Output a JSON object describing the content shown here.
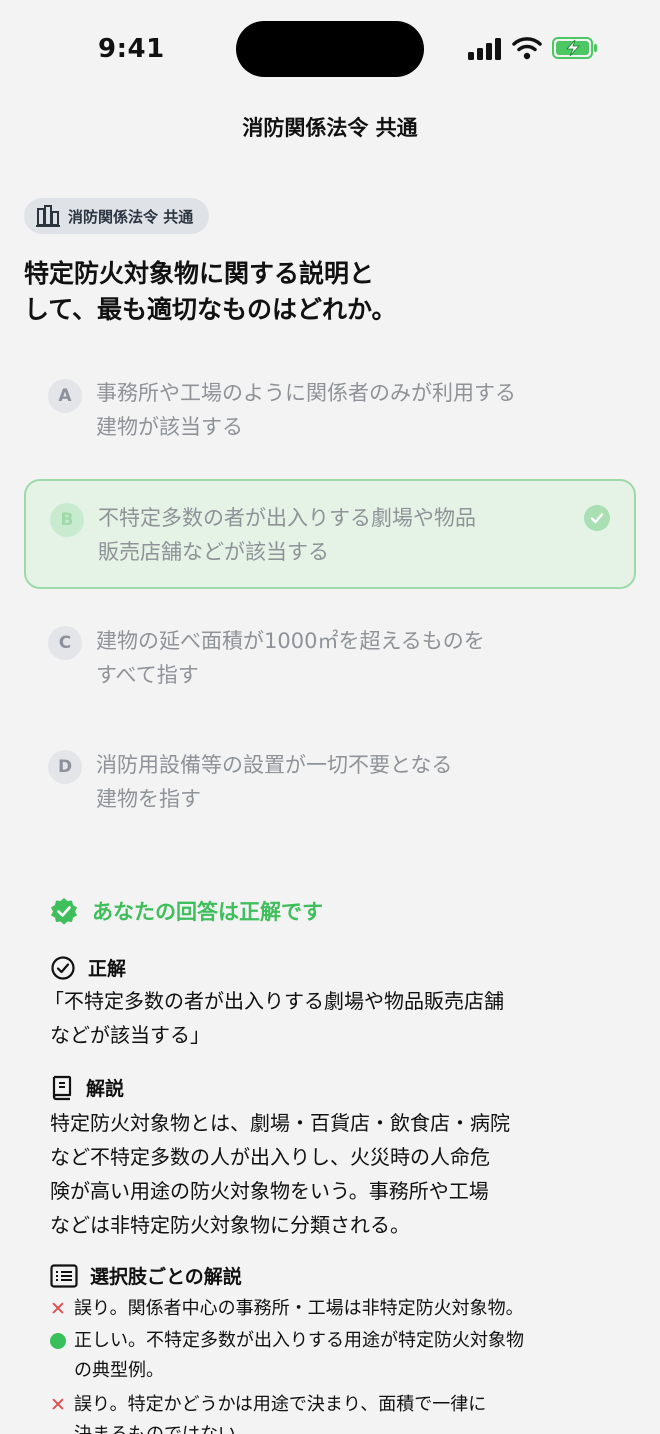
{
  "status_bar": {
    "time": "9:41"
  },
  "nav": {
    "title": "消防関係法令 共通"
  },
  "tag": {
    "label": "消防関係法令 共通"
  },
  "question": {
    "line1": "特定防火対象物に関する説明と",
    "line2": "して、最も適切なものはどれか。"
  },
  "options": [
    {
      "letter": "A",
      "line1": "事務所や工場のように関係者のみが利用する",
      "line2": "建物が該当する"
    },
    {
      "letter": "B",
      "line1": "不特定多数の者が出入りする劇場や物品",
      "line2": "販売店舗などが該当する"
    },
    {
      "letter": "C",
      "line1": "建物の延べ面積が1000㎡を超えるものを",
      "line2": "すべて指す"
    },
    {
      "letter": "D",
      "line1": "消防用設備等の設置が一切不要となる",
      "line2": "建物を指す"
    }
  ],
  "result": {
    "label": "あなたの回答は正解です"
  },
  "correct": {
    "heading": "正解",
    "line1": "「不特定多数の者が出入りする劇場や物品販売店舗",
    "line2": "などが該当する」"
  },
  "explanation": {
    "heading": "解説",
    "line1": "特定防火対象物とは、劇場・百貨店・飲食店・病院",
    "line2": "など不特定多数の人が出入りし、火災時の人命危",
    "line3": "険が高い用途の防火対象物をいう。事務所や工場",
    "line4": "などは非特定防火対象物に分類される。"
  },
  "per_option": {
    "heading": "選択肢ごとの解説",
    "items": [
      {
        "mark": "✕",
        "line1": "誤り。関係者中心の事務所・工場は非特定防火対象物。",
        "line2": ""
      },
      {
        "mark": "●",
        "line1": "正しい。不特定多数が出入りする用途が特定防火対象物",
        "line2": "の典型例。"
      },
      {
        "mark": "✕",
        "line1": "誤り。特定かどうかは用途で決まり、面積で一律に",
        "line2": "決まるものではない。"
      }
    ]
  },
  "colors": {
    "correct_green": "#3fbf5c",
    "wrong_red": "#e04b4b",
    "selected_border": "#9ed9aa"
  },
  "icons": {
    "tag": "building-icon",
    "result": "verified-badge-icon",
    "correct": "check-circle-icon",
    "explanation": "book-icon",
    "per_option": "list-icon",
    "selected": "check-icon"
  }
}
